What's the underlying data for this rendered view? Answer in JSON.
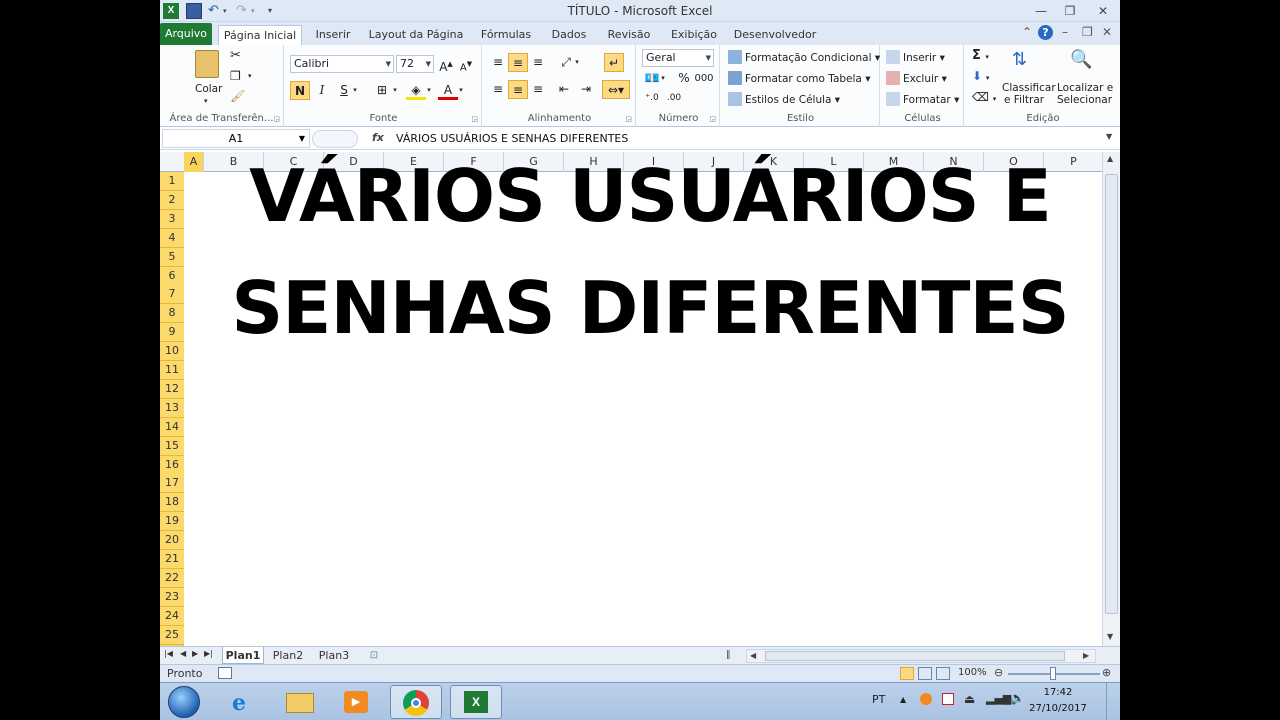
{
  "window": {
    "title": "TÍTULO  -  Microsoft Excel"
  },
  "ribbon": {
    "tabs": [
      {
        "label": "Arquivo"
      },
      {
        "label": "Página Inicial"
      },
      {
        "label": "Inserir"
      },
      {
        "label": "Layout da Página"
      },
      {
        "label": "Fórmulas"
      },
      {
        "label": "Dados"
      },
      {
        "label": "Revisão"
      },
      {
        "label": "Exibição"
      },
      {
        "label": "Desenvolvedor"
      }
    ],
    "groups": {
      "clipboard": {
        "label": "Área de Transferên...",
        "paste": "Colar"
      },
      "font": {
        "label": "Fonte",
        "name": "Calibri",
        "size": "72",
        "bold": "N",
        "italic": "I",
        "underline": "S"
      },
      "alignment": {
        "label": "Alinhamento"
      },
      "number": {
        "label": "Número",
        "format": "Geral",
        "percent": "%",
        "thousands": "000"
      },
      "styles": {
        "label": "Estilo",
        "conditional": "Formatação Condicional",
        "table": "Formatar como Tabela",
        "cell": "Estilos de Célula"
      },
      "cells": {
        "label": "Células",
        "insert": "Inserir",
        "delete": "Excluir",
        "format": "Formatar"
      },
      "editing": {
        "label": "Edição",
        "sort_line1": "Classificar",
        "sort_line2": "e Filtrar",
        "find_line1": "Localizar e",
        "find_line2": "Selecionar",
        "sigma": "Σ"
      }
    }
  },
  "formula_bar": {
    "name_box": "A1",
    "fx": "fx",
    "value": "VÁRIOS USUÁRIOS E SENHAS DIFERENTES"
  },
  "grid": {
    "columns": [
      "A",
      "B",
      "C",
      "D",
      "E",
      "F",
      "G",
      "H",
      "I",
      "J",
      "K",
      "L",
      "M",
      "N",
      "O",
      "P"
    ],
    "rows": [
      "1",
      "2",
      "3",
      "4",
      "5",
      "6",
      "7",
      "8",
      "9",
      "10",
      "11",
      "12",
      "13",
      "14",
      "15",
      "16",
      "17",
      "18",
      "19",
      "20",
      "21",
      "22",
      "23",
      "24",
      "25"
    ],
    "cell_text_line1": "VÁRIOS USUÁRIOS E",
    "cell_text_line2": "SENHAS DIFERENTES"
  },
  "sheets": [
    {
      "label": "Plan1"
    },
    {
      "label": "Plan2"
    },
    {
      "label": "Plan3"
    }
  ],
  "status": {
    "ready": "Pronto",
    "zoom": "100%"
  },
  "taskbar": {
    "language": "PT",
    "time": "17:42",
    "date": "27/10/2017"
  },
  "colors": {
    "file_tab": "#1f7b34",
    "row_header": "#fbd96a",
    "highlight": "#fbd985"
  }
}
